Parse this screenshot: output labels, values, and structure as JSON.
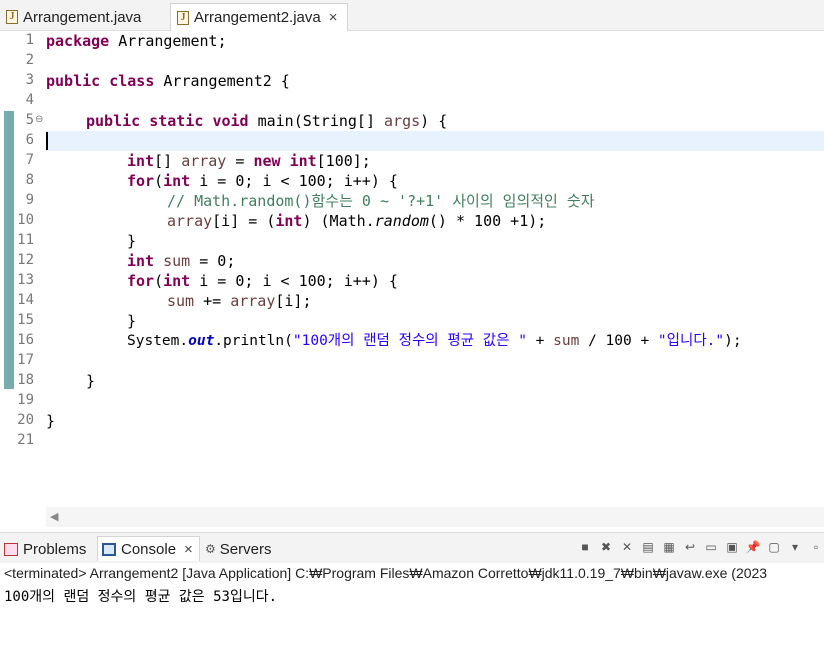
{
  "editor_tabs": [
    {
      "label": "Arrangement.java"
    },
    {
      "label": "Arrangement2.java",
      "close": "×"
    }
  ],
  "line_numbers": [
    "1",
    "2",
    "3",
    "4",
    "5",
    "6",
    "7",
    "8",
    "9",
    "10",
    "11",
    "12",
    "13",
    "14",
    "15",
    "16",
    "17",
    "18",
    "19",
    "20",
    "21"
  ],
  "fold_marker": "⊖",
  "code": {
    "l1_kw": "package",
    "l1_rest": " Arrangement;",
    "l3_kw1": "public",
    "l3_kw2": "class",
    "l3_rest": " Arrangement2 {",
    "l5_kw1": "public",
    "l5_kw2": "static",
    "l5_kw3": "void",
    "l5_a": " main(String[] ",
    "l5_var": "args",
    "l5_b": ") {",
    "l7_kw1": "int",
    "l7_a": "[] ",
    "l7_var": "array",
    "l7_b": " = ",
    "l7_kw2": "new",
    "l7_kw3": "int",
    "l7_c": "[100];",
    "l8_kw1": "for",
    "l8_a": "(",
    "l8_kw2": "int",
    "l8_b": " i = 0; i < 100; i++) {",
    "l9_cmt": "// Math.random()함수는 0 ~ '?+1' 사이의 임의적인 숫자",
    "l10_var": "array",
    "l10_a": "[i] = (",
    "l10_kw": "int",
    "l10_b": ") (Math.",
    "l10_ital": "random",
    "l10_c": "() * 100 +1);",
    "l11": "}",
    "l12_kw": "int",
    "l12_a": " ",
    "l12_var": "sum",
    "l12_b": " = 0;",
    "l13_kw1": "for",
    "l13_a": "(",
    "l13_kw2": "int",
    "l13_b": " i = 0; i < 100; i++) {",
    "l14_var1": "sum",
    "l14_a": " += ",
    "l14_var2": "array",
    "l14_b": "[i];",
    "l15": "}",
    "l16_a": "System.",
    "l16_fld": "out",
    "l16_b": ".println(",
    "l16_str1": "\"100개의 랜덤 정수의 평균 값은 \"",
    "l16_c": " + ",
    "l16_var": "sum",
    "l16_d": " / 100 + ",
    "l16_str2": "\"입니다.\"",
    "l16_e": ");",
    "l18": "}",
    "l20": "}"
  },
  "bottom_panel": {
    "tabs": [
      {
        "label": "Problems"
      },
      {
        "label": "Console",
        "close": "×"
      },
      {
        "label": "Servers"
      }
    ],
    "status": "<terminated> Arrangement2 [Java Application] C:₩Program Files₩Amazon Corretto₩jdk11.0.19_7₩bin₩javaw.exe  (2023",
    "output": "100개의 랜덤 정수의 평균 값은 53입니다."
  }
}
